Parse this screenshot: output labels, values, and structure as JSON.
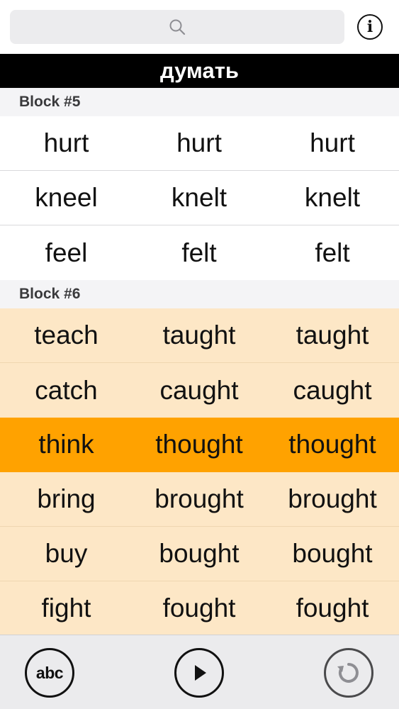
{
  "search": {
    "value": "",
    "placeholder": ""
  },
  "header": {
    "info_icon": "info-icon",
    "info_glyph": "i",
    "title": "думать"
  },
  "colors": {
    "title_bar": "#000000",
    "highlight_row": "#ffa200",
    "tinted_row": "#fde7c6",
    "section_header": "#f4f4f6"
  },
  "blocks": [
    {
      "label": "Block #5",
      "rows": [
        [
          "hurt",
          "hurt",
          "hurt"
        ],
        [
          "kneel",
          "knelt",
          "knelt"
        ],
        [
          "feel",
          "felt",
          "felt"
        ]
      ]
    },
    {
      "label": "Block #6",
      "rows": [
        [
          "teach",
          "taught",
          "taught"
        ],
        [
          "catch",
          "caught",
          "caught"
        ],
        [
          "think",
          "thought",
          "thought"
        ],
        [
          "bring",
          "brought",
          "brought"
        ],
        [
          "buy",
          "bought",
          "bought"
        ],
        [
          "fight",
          "fought",
          "fought"
        ]
      ]
    }
  ],
  "toolbar": {
    "abc_label": "abc",
    "play_icon": "play-icon",
    "reset_icon": "reset-icon"
  }
}
